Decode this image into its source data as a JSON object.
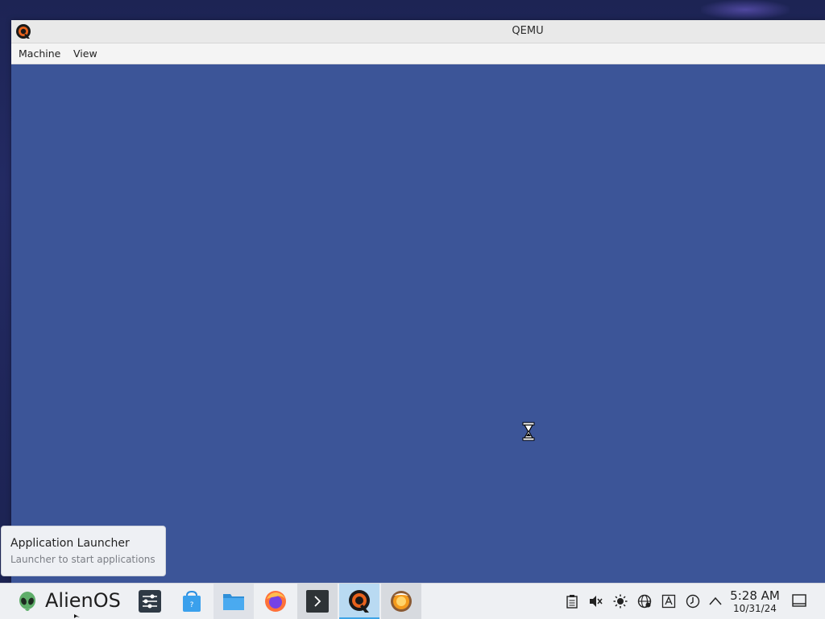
{
  "window": {
    "title": "QEMU",
    "menu": [
      "Machine",
      "View"
    ]
  },
  "tooltip": {
    "title": "Application Launcher",
    "subtitle": "Launcher to start applications"
  },
  "taskbar": {
    "launcher_label": "AlienOS",
    "tasks": [
      {
        "icon": "system-settings-icon"
      },
      {
        "icon": "discover-store-icon"
      },
      {
        "icon": "file-manager-icon"
      },
      {
        "icon": "firefox-icon"
      },
      {
        "icon": "terminal-icon"
      },
      {
        "icon": "qemu-icon",
        "active": true
      },
      {
        "icon": "app-orange-icon"
      }
    ],
    "clock": {
      "time": "5:28 AM",
      "date": "10/31/24"
    }
  },
  "colors": {
    "guest_screen": "#3c5598",
    "taskbar": "#eef0f3",
    "active_task_highlight": "#b9daf2"
  }
}
